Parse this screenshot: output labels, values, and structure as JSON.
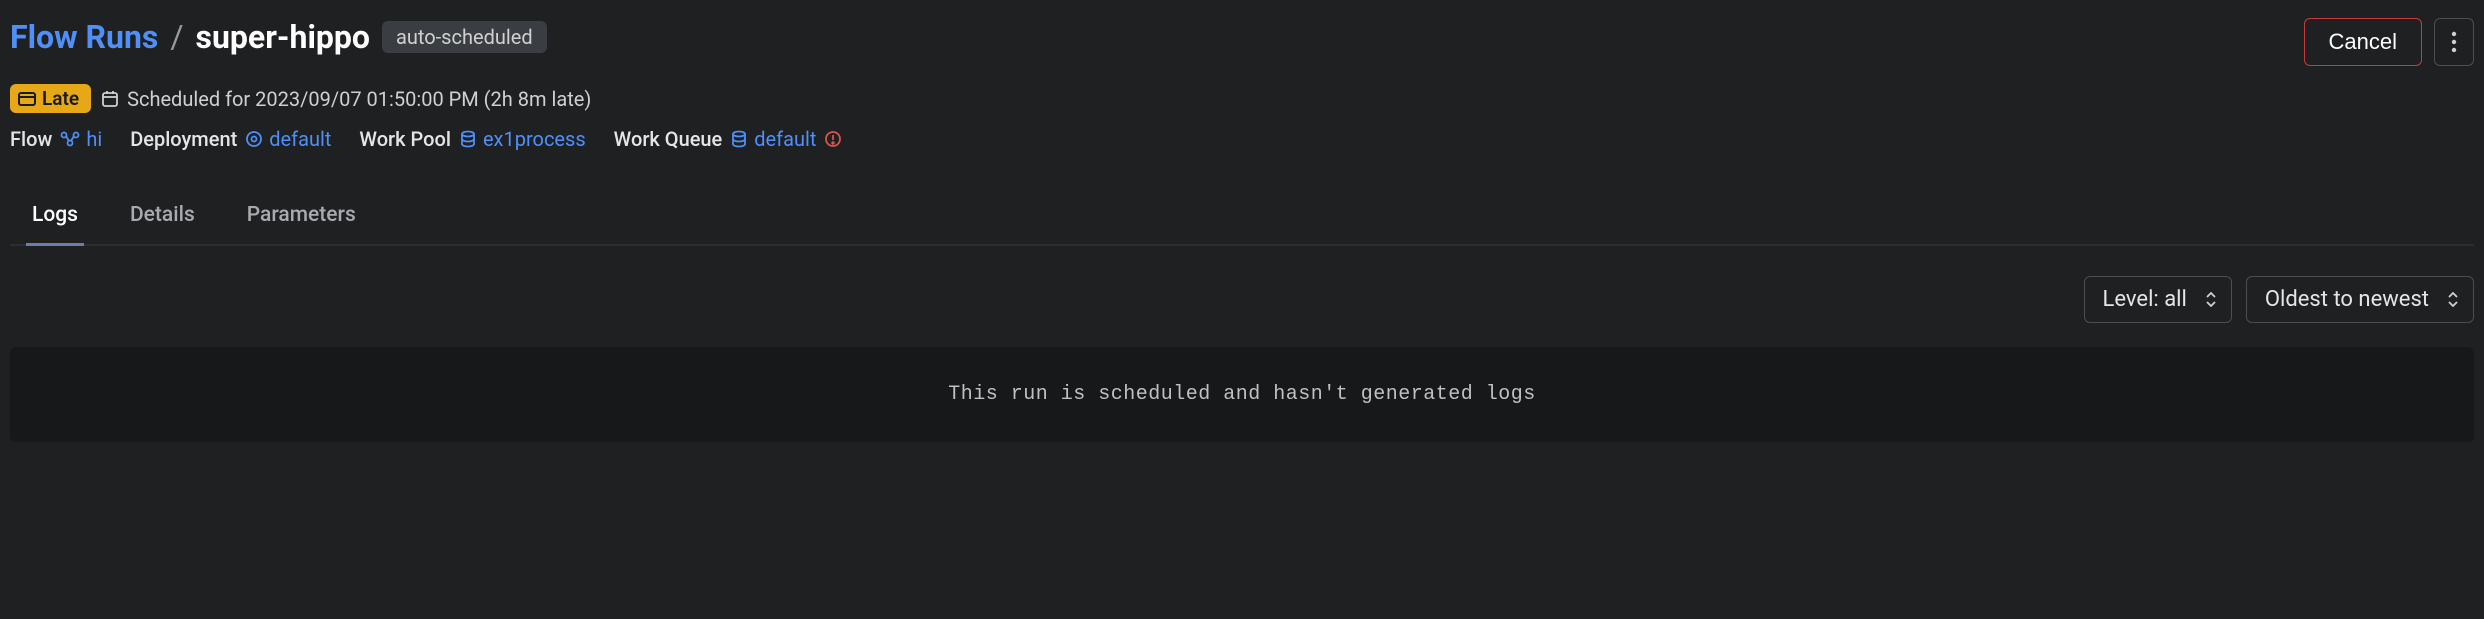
{
  "breadcrumb": {
    "root": "Flow Runs",
    "separator": "/",
    "current": "super-hippo"
  },
  "tag": "auto-scheduled",
  "actions": {
    "cancel": "Cancel"
  },
  "status": {
    "badge": "Late",
    "scheduled_text": "Scheduled for 2023/09/07 01:50:00 PM (2h 8m late)"
  },
  "meta": {
    "flow_label": "Flow",
    "flow_link": "hi",
    "deployment_label": "Deployment",
    "deployment_link": "default",
    "workpool_label": "Work Pool",
    "workpool_link": "ex1process",
    "workqueue_label": "Work Queue",
    "workqueue_link": "default"
  },
  "tabs": {
    "logs": "Logs",
    "details": "Details",
    "parameters": "Parameters"
  },
  "log_controls": {
    "level": "Level: all",
    "sort": "Oldest to newest"
  },
  "logs_empty": "This run is scheduled and hasn't generated logs"
}
